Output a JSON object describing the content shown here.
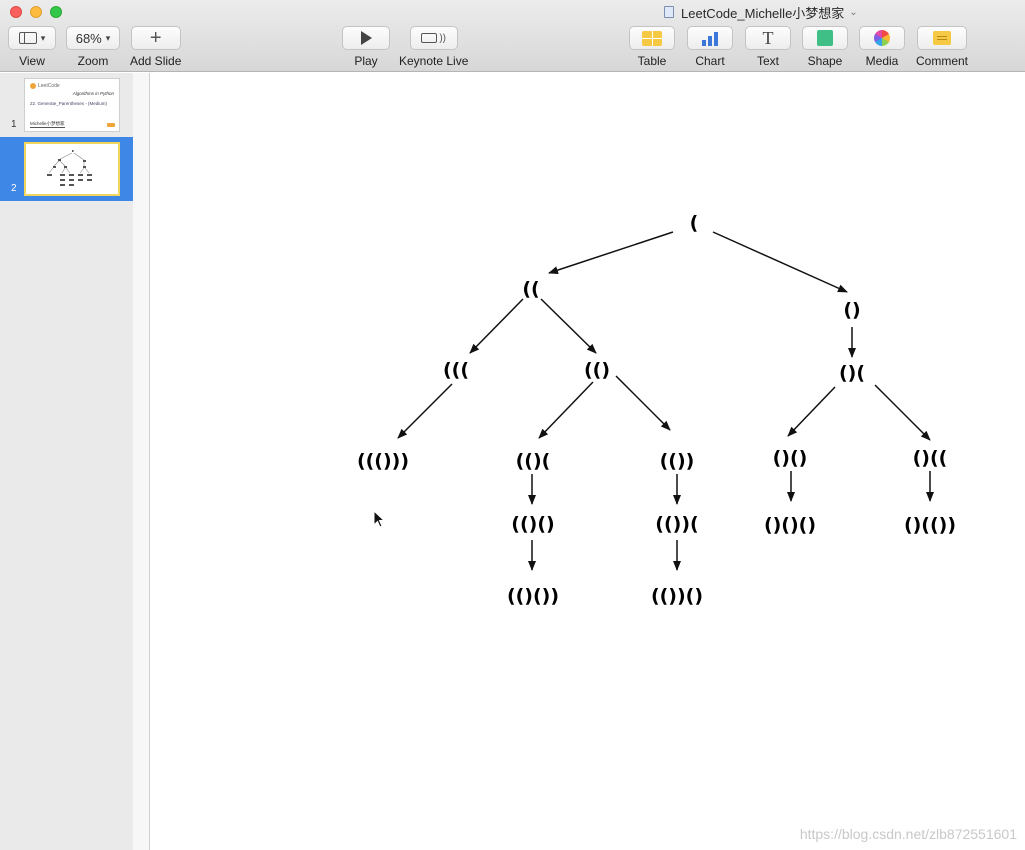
{
  "window": {
    "title": "LeetCode_Michelle小梦想家"
  },
  "toolbar": {
    "view_label": "View",
    "zoom_value": "68%",
    "zoom_label": "Zoom",
    "add_slide_label": "Add Slide",
    "play_label": "Play",
    "keynote_live_label": "Keynote Live",
    "table_label": "Table",
    "chart_label": "Chart",
    "text_label": "Text",
    "shape_label": "Shape",
    "media_label": "Media",
    "comment_label": "Comment"
  },
  "sidebar": {
    "slides": [
      {
        "number": "1",
        "thumb_logo": "LeetCode",
        "thumb_title": "Algorithms in Python",
        "thumb_subtitle": "22. Generate_Parentheses - (Medium)",
        "thumb_author": "Michelle小梦想家"
      },
      {
        "number": "2"
      }
    ]
  },
  "tree": {
    "nodes": {
      "root": "(",
      "l1a": "((",
      "l1b": "()",
      "l2a": "(((",
      "l2b": "(()",
      "l2c": "()(",
      "l3a": "((()))",
      "l3b": "(()(",
      "l3c": "(())",
      "l3d": "()()",
      "l3e": "()((",
      "l4a": "(()()",
      "l4b": "(())(",
      "l4c": "()()()",
      "l4d": "()(())",
      "l5a": "(()())",
      "l5b": "(())()"
    }
  },
  "watermark": "https://blog.csdn.net/zlb872551601"
}
